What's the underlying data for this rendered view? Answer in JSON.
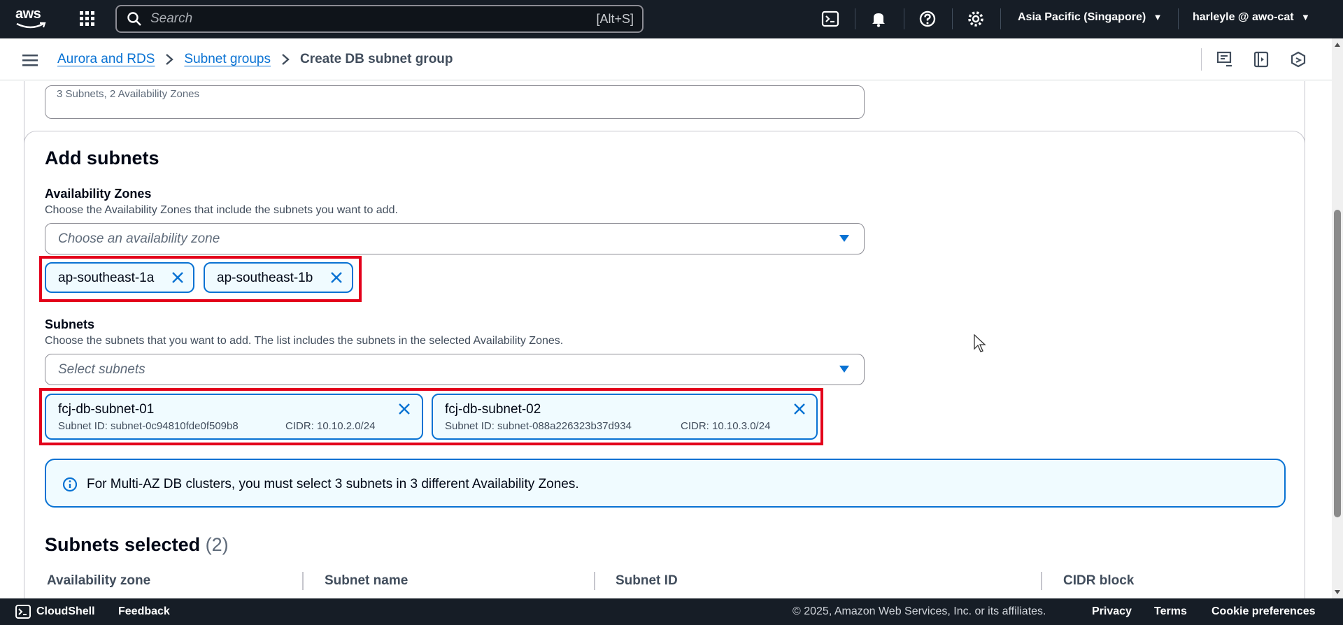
{
  "topnav": {
    "logo_text": "aws",
    "search_placeholder": "Search",
    "search_shortcut": "[Alt+S]",
    "region": "Asia Pacific (Singapore)",
    "user": "harleyle @ awo-cat"
  },
  "breadcrumb": {
    "items": [
      "Aurora and RDS",
      "Subnet groups"
    ],
    "current": "Create DB subnet group"
  },
  "top_card": {
    "field_text": "3 Subnets, 2 Availability Zones"
  },
  "add_subnets": {
    "title": "Add subnets",
    "az_label": "Availability Zones",
    "az_desc": "Choose the Availability Zones that include the subnets you want to add.",
    "az_placeholder": "Choose an availability zone",
    "az_tokens": [
      "ap-southeast-1a",
      "ap-southeast-1b"
    ],
    "subnets_label": "Subnets",
    "subnets_desc": "Choose the subnets that you want to add. The list includes the subnets in the selected Availability Zones.",
    "subnets_placeholder": "Select subnets",
    "subnet_tokens": [
      {
        "name": "fcj-db-subnet-01",
        "subnet_id": "Subnet ID: subnet-0c94810fde0f509b8",
        "cidr": "CIDR: 10.10.2.0/24"
      },
      {
        "name": "fcj-db-subnet-02",
        "subnet_id": "Subnet ID: subnet-088a226323b37d934",
        "cidr": "CIDR: 10.10.3.0/24"
      }
    ],
    "alert": "For Multi-AZ DB clusters, you must select 3 subnets in 3 different Availability Zones."
  },
  "subnets_selected": {
    "title": "Subnets selected",
    "count": "(2)",
    "columns": [
      "Availability zone",
      "Subnet name",
      "Subnet ID",
      "CIDR block"
    ]
  },
  "footer": {
    "cloudshell": "CloudShell",
    "feedback": "Feedback",
    "copyright": "© 2025, Amazon Web Services, Inc. or its affiliates.",
    "privacy": "Privacy",
    "terms": "Terms",
    "cookie": "Cookie preferences"
  },
  "colors": {
    "nav_bg": "#161d26",
    "link": "#0972d3",
    "highlight": "#e3001b",
    "token_bg": "#f0fbff"
  }
}
